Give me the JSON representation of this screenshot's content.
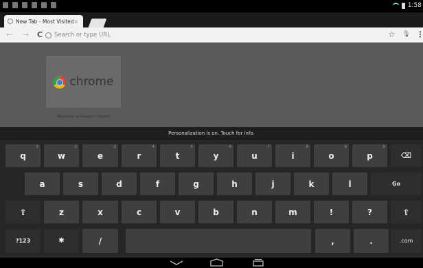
{
  "status_bar": {
    "time": "1:58"
  },
  "tab_strip": {
    "active_tab_title": "New Tab - Most Visited",
    "close_glyph": "×"
  },
  "toolbar": {
    "back_glyph": "←",
    "forward_glyph": "→",
    "reload_glyph": "C",
    "omnibox_placeholder": "Search or type URL",
    "star_glyph": "☆",
    "mic_glyph": "🎙",
    "menu_glyph": "⋮"
  },
  "page": {
    "most_visited_logo_text": "chrome",
    "most_visited_caption": "Welcome to Google Chrome"
  },
  "keyboard": {
    "hint": "Personalization is on. Touch for info.",
    "row1": [
      {
        "label": "q",
        "hint": "1"
      },
      {
        "label": "w",
        "hint": "2"
      },
      {
        "label": "e",
        "hint": "3"
      },
      {
        "label": "r",
        "hint": "4"
      },
      {
        "label": "t",
        "hint": "5"
      },
      {
        "label": "y",
        "hint": "6"
      },
      {
        "label": "u",
        "hint": "7"
      },
      {
        "label": "i",
        "hint": "8"
      },
      {
        "label": "o",
        "hint": "9"
      },
      {
        "label": "p",
        "hint": "0"
      }
    ],
    "backspace_glyph": "⌫",
    "row2": [
      "a",
      "s",
      "d",
      "f",
      "g",
      "h",
      "j",
      "k",
      "l"
    ],
    "go_label": "Go",
    "shift_glyph": "⇧",
    "row3": [
      "z",
      "x",
      "c",
      "v",
      "b",
      "n",
      "m",
      "!",
      "?"
    ],
    "symbols_label": "?123",
    "settings_glyph": "✱",
    "slash_label": "/",
    "comma_label": ",",
    "period_label": ".",
    "dotcom_label": ".com"
  }
}
